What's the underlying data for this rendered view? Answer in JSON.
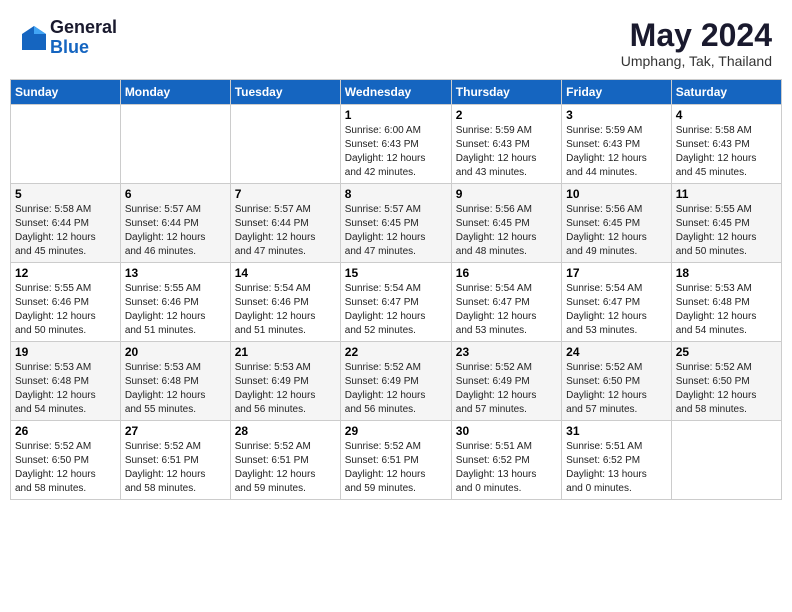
{
  "header": {
    "logo_general": "General",
    "logo_blue": "Blue",
    "month_year": "May 2024",
    "location": "Umphang, Tak, Thailand"
  },
  "days_of_week": [
    "Sunday",
    "Monday",
    "Tuesday",
    "Wednesday",
    "Thursday",
    "Friday",
    "Saturday"
  ],
  "weeks": [
    [
      {
        "day": "",
        "info": ""
      },
      {
        "day": "",
        "info": ""
      },
      {
        "day": "",
        "info": ""
      },
      {
        "day": "1",
        "info": "Sunrise: 6:00 AM\nSunset: 6:43 PM\nDaylight: 12 hours\nand 42 minutes."
      },
      {
        "day": "2",
        "info": "Sunrise: 5:59 AM\nSunset: 6:43 PM\nDaylight: 12 hours\nand 43 minutes."
      },
      {
        "day": "3",
        "info": "Sunrise: 5:59 AM\nSunset: 6:43 PM\nDaylight: 12 hours\nand 44 minutes."
      },
      {
        "day": "4",
        "info": "Sunrise: 5:58 AM\nSunset: 6:43 PM\nDaylight: 12 hours\nand 45 minutes."
      }
    ],
    [
      {
        "day": "5",
        "info": "Sunrise: 5:58 AM\nSunset: 6:44 PM\nDaylight: 12 hours\nand 45 minutes."
      },
      {
        "day": "6",
        "info": "Sunrise: 5:57 AM\nSunset: 6:44 PM\nDaylight: 12 hours\nand 46 minutes."
      },
      {
        "day": "7",
        "info": "Sunrise: 5:57 AM\nSunset: 6:44 PM\nDaylight: 12 hours\nand 47 minutes."
      },
      {
        "day": "8",
        "info": "Sunrise: 5:57 AM\nSunset: 6:45 PM\nDaylight: 12 hours\nand 47 minutes."
      },
      {
        "day": "9",
        "info": "Sunrise: 5:56 AM\nSunset: 6:45 PM\nDaylight: 12 hours\nand 48 minutes."
      },
      {
        "day": "10",
        "info": "Sunrise: 5:56 AM\nSunset: 6:45 PM\nDaylight: 12 hours\nand 49 minutes."
      },
      {
        "day": "11",
        "info": "Sunrise: 5:55 AM\nSunset: 6:45 PM\nDaylight: 12 hours\nand 50 minutes."
      }
    ],
    [
      {
        "day": "12",
        "info": "Sunrise: 5:55 AM\nSunset: 6:46 PM\nDaylight: 12 hours\nand 50 minutes."
      },
      {
        "day": "13",
        "info": "Sunrise: 5:55 AM\nSunset: 6:46 PM\nDaylight: 12 hours\nand 51 minutes."
      },
      {
        "day": "14",
        "info": "Sunrise: 5:54 AM\nSunset: 6:46 PM\nDaylight: 12 hours\nand 51 minutes."
      },
      {
        "day": "15",
        "info": "Sunrise: 5:54 AM\nSunset: 6:47 PM\nDaylight: 12 hours\nand 52 minutes."
      },
      {
        "day": "16",
        "info": "Sunrise: 5:54 AM\nSunset: 6:47 PM\nDaylight: 12 hours\nand 53 minutes."
      },
      {
        "day": "17",
        "info": "Sunrise: 5:54 AM\nSunset: 6:47 PM\nDaylight: 12 hours\nand 53 minutes."
      },
      {
        "day": "18",
        "info": "Sunrise: 5:53 AM\nSunset: 6:48 PM\nDaylight: 12 hours\nand 54 minutes."
      }
    ],
    [
      {
        "day": "19",
        "info": "Sunrise: 5:53 AM\nSunset: 6:48 PM\nDaylight: 12 hours\nand 54 minutes."
      },
      {
        "day": "20",
        "info": "Sunrise: 5:53 AM\nSunset: 6:48 PM\nDaylight: 12 hours\nand 55 minutes."
      },
      {
        "day": "21",
        "info": "Sunrise: 5:53 AM\nSunset: 6:49 PM\nDaylight: 12 hours\nand 56 minutes."
      },
      {
        "day": "22",
        "info": "Sunrise: 5:52 AM\nSunset: 6:49 PM\nDaylight: 12 hours\nand 56 minutes."
      },
      {
        "day": "23",
        "info": "Sunrise: 5:52 AM\nSunset: 6:49 PM\nDaylight: 12 hours\nand 57 minutes."
      },
      {
        "day": "24",
        "info": "Sunrise: 5:52 AM\nSunset: 6:50 PM\nDaylight: 12 hours\nand 57 minutes."
      },
      {
        "day": "25",
        "info": "Sunrise: 5:52 AM\nSunset: 6:50 PM\nDaylight: 12 hours\nand 58 minutes."
      }
    ],
    [
      {
        "day": "26",
        "info": "Sunrise: 5:52 AM\nSunset: 6:50 PM\nDaylight: 12 hours\nand 58 minutes."
      },
      {
        "day": "27",
        "info": "Sunrise: 5:52 AM\nSunset: 6:51 PM\nDaylight: 12 hours\nand 58 minutes."
      },
      {
        "day": "28",
        "info": "Sunrise: 5:52 AM\nSunset: 6:51 PM\nDaylight: 12 hours\nand 59 minutes."
      },
      {
        "day": "29",
        "info": "Sunrise: 5:52 AM\nSunset: 6:51 PM\nDaylight: 12 hours\nand 59 minutes."
      },
      {
        "day": "30",
        "info": "Sunrise: 5:51 AM\nSunset: 6:52 PM\nDaylight: 13 hours\nand 0 minutes."
      },
      {
        "day": "31",
        "info": "Sunrise: 5:51 AM\nSunset: 6:52 PM\nDaylight: 13 hours\nand 0 minutes."
      },
      {
        "day": "",
        "info": ""
      }
    ]
  ]
}
